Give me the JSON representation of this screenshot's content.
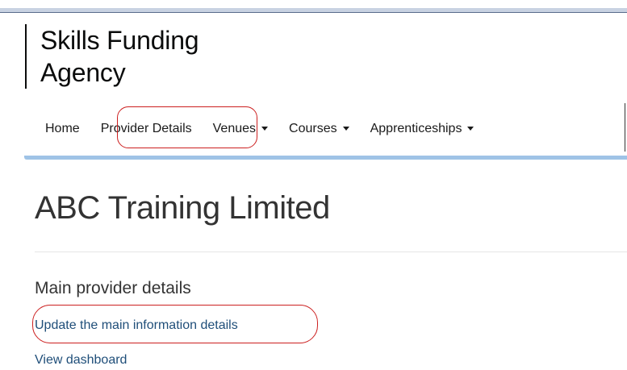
{
  "header": {
    "logo_line_1": "Skills Funding",
    "logo_line_2": "Agency"
  },
  "nav": {
    "items": [
      {
        "label": "Home",
        "dropdown": false
      },
      {
        "label": "Provider Details",
        "dropdown": false
      },
      {
        "label": "Venues",
        "dropdown": true
      },
      {
        "label": "Courses",
        "dropdown": true
      },
      {
        "label": "Apprenticeships",
        "dropdown": true
      }
    ]
  },
  "main": {
    "page_title": "ABC Training Limited",
    "section_title": "Main provider details",
    "links": {
      "update": "Update the main information details",
      "dashboard": "View dashboard"
    }
  },
  "colors": {
    "link": "#1f4e79",
    "highlight": "#cc1f1f",
    "nav_shadow": "#9fc3e6"
  }
}
